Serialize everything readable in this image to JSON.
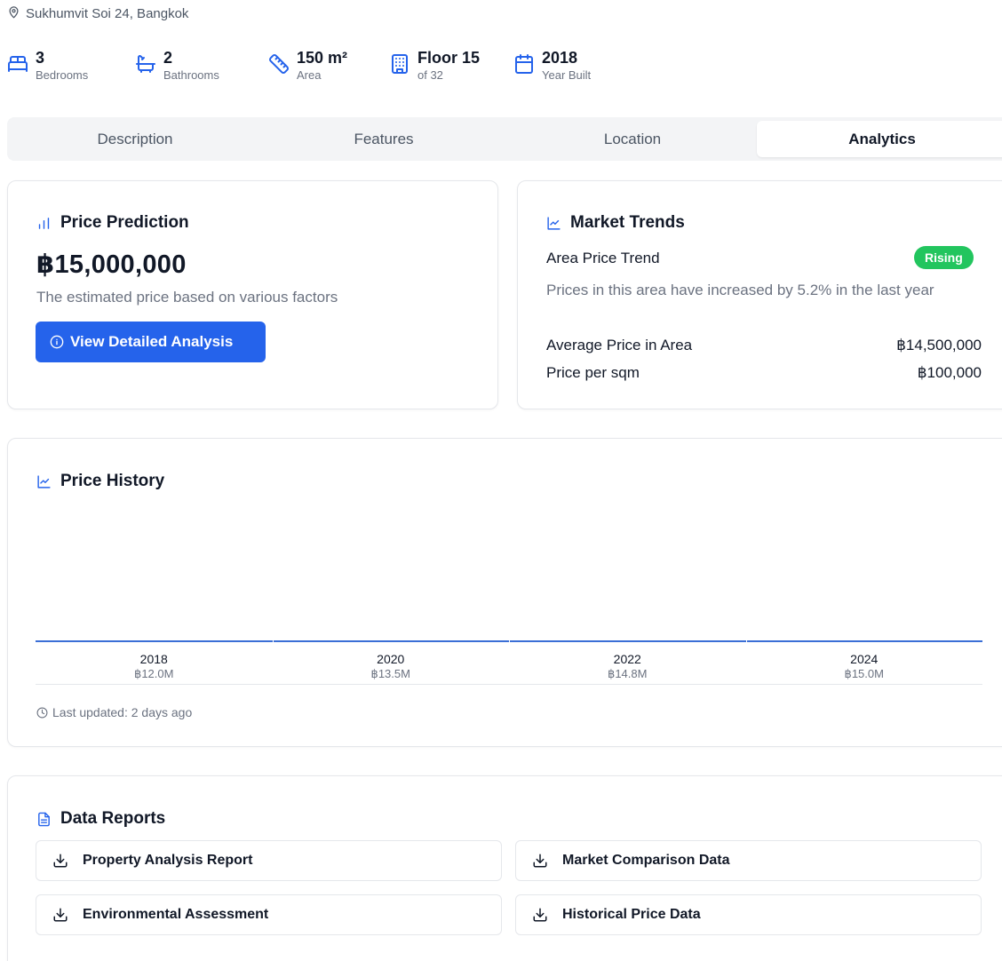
{
  "location": {
    "text": "Sukhumvit Soi 24, Bangkok",
    "icon": "map-pin-icon"
  },
  "stats": [
    {
      "value": "3",
      "label": "Bedrooms",
      "icon": "bed-icon"
    },
    {
      "value": "2",
      "label": "Bathrooms",
      "icon": "bath-icon"
    },
    {
      "value": "150 m²",
      "label": "Area",
      "icon": "ruler-icon"
    },
    {
      "value": "Floor 15",
      "label": "of 32",
      "icon": "building-icon"
    },
    {
      "value": "2018",
      "label": "Year Built",
      "icon": "calendar-icon"
    }
  ],
  "tabs": [
    {
      "label": "Description"
    },
    {
      "label": "Features"
    },
    {
      "label": "Location"
    },
    {
      "label": "Analytics"
    }
  ],
  "active_tab": "Analytics",
  "prediction": {
    "title": "Price Prediction",
    "price": "฿15,000,000",
    "description": "The estimated price based on various factors",
    "button_label": "View Detailed Analysis"
  },
  "market": {
    "title": "Market Trends",
    "trend_label": "Area Price Trend",
    "trend_badge": "Rising",
    "trend_description": "Prices in this area have increased by 5.2% in the last year",
    "avg_label": "Average Price in Area",
    "avg_value": "฿14,500,000",
    "sqm_label": "Price per sqm",
    "sqm_value": "฿100,000"
  },
  "history": {
    "title": "Price History",
    "footnote": "Last updated: 2 days ago"
  },
  "chart_data": {
    "type": "bar",
    "categories": [
      "2018",
      "2020",
      "2022",
      "2024"
    ],
    "values": [
      12.0,
      13.5,
      14.8,
      15.0
    ],
    "value_labels": [
      "฿12.0M",
      "฿13.5M",
      "฿14.8M",
      "฿15.0M"
    ],
    "title": "Price History",
    "xlabel": "",
    "ylabel": ""
  },
  "reports": {
    "title": "Data Reports",
    "items": [
      {
        "label": "Property Analysis Report"
      },
      {
        "label": "Market Comparison Data"
      },
      {
        "label": "Environmental Assessment"
      },
      {
        "label": "Historical Price Data"
      }
    ]
  },
  "colors": {
    "accent": "#2563eb",
    "badge": "#22c55e"
  }
}
